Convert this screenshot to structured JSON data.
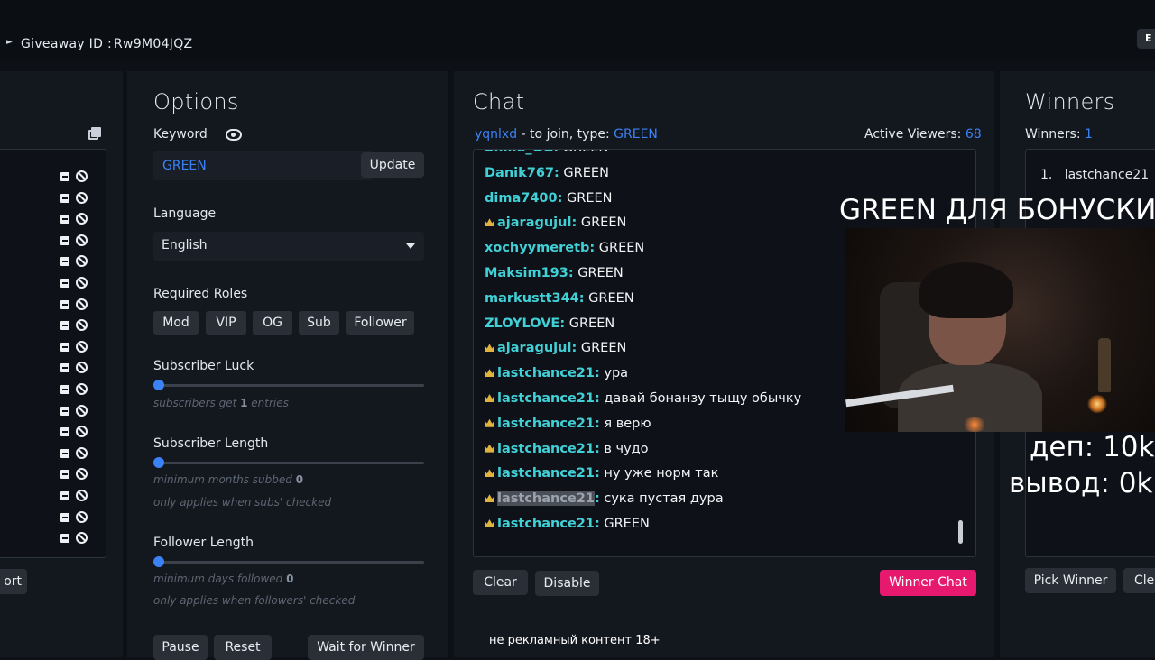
{
  "header": {
    "giveaway_label": "Giveaway ID :",
    "giveaway_id": "Rw9M04JQZ",
    "corner_button": "E"
  },
  "entries": {
    "export_label": "ort"
  },
  "options": {
    "title": "Options",
    "keyword_label": "Keyword",
    "keyword_value": "GREEN",
    "update_label": "Update",
    "language_label": "Language",
    "language_value": "English",
    "roles_label": "Required Roles",
    "roles": [
      "Mod",
      "VIP",
      "OG",
      "Sub",
      "Follower"
    ],
    "sub_luck": {
      "label": "Subscriber Luck",
      "hint_pre": "subscribers get ",
      "hint_val": "1",
      "hint_post": " entries",
      "value": 1
    },
    "sub_length": {
      "label": "Subscriber Length",
      "hint_pre": "minimum months subbed ",
      "hint_val": "0",
      "hint2": "only applies when subs' checked",
      "value": 0
    },
    "follower_length": {
      "label": "Follower Length",
      "hint_pre": "minimum days followed ",
      "hint_val": "0",
      "hint2": "only applies when followers' checked",
      "value": 0
    },
    "pause_label": "Pause",
    "reset_label": "Reset",
    "wait_label": "Wait for Winner"
  },
  "chat": {
    "title": "Chat",
    "channel": "yqnlxd",
    "join_text": " - to join, type: ",
    "join_keyword": "GREEN",
    "viewers_label": "Active Viewers: ",
    "viewers_count": "68",
    "clear_label": "Clear",
    "disable_label": "Disable",
    "winner_chat_label": "Winner Chat",
    "messages": [
      {
        "user": "Smile_GG:",
        "text": " GREEN",
        "crown": false
      },
      {
        "user": "Danik767:",
        "text": " GREEN",
        "crown": false
      },
      {
        "user": "dima7400:",
        "text": " GREEN",
        "crown": false
      },
      {
        "user": "ajaragujul:",
        "text": " GREEN",
        "crown": true
      },
      {
        "user": "xochyymeretb:",
        "text": " GREEN",
        "crown": false
      },
      {
        "user": "Maksim193:",
        "text": " GREEN",
        "crown": false
      },
      {
        "user": "markustt344:",
        "text": " GREEN",
        "crown": false
      },
      {
        "user": "ZLOYLOVE:",
        "text": " GREEN",
        "crown": false
      },
      {
        "user": "ajaragujul:",
        "text": " GREEN",
        "crown": true
      },
      {
        "user": "lastchance21:",
        "text": " ура",
        "crown": true
      },
      {
        "user": "lastchance21:",
        "text": " давай бонанзу тыщу обычку",
        "crown": true
      },
      {
        "user": "lastchance21:",
        "text": " я верю",
        "crown": true
      },
      {
        "user": "lastchance21:",
        "text": " в чудо",
        "crown": true
      },
      {
        "user": "lastchance21:",
        "text": " ну уже норм так",
        "crown": true
      },
      {
        "user": "lastchance21",
        "user_suffix": ":",
        "text": " сука пустая дура",
        "crown": true,
        "highlight": true
      },
      {
        "user": "lastchance21:",
        "text": " GREEN",
        "crown": true
      }
    ]
  },
  "winners": {
    "title": "Winners",
    "count_label": "Winners: ",
    "count": "1",
    "list": [
      "lastchance21"
    ],
    "pick_label": "Pick Winner",
    "clear_label": "Cle"
  },
  "overlay": {
    "title": "GREEN ДЛЯ БОНУСКИ",
    "deposit": "деп: 10k",
    "withdraw": "вывод: 0k",
    "ad_text": "не рекламный контент 18+"
  }
}
